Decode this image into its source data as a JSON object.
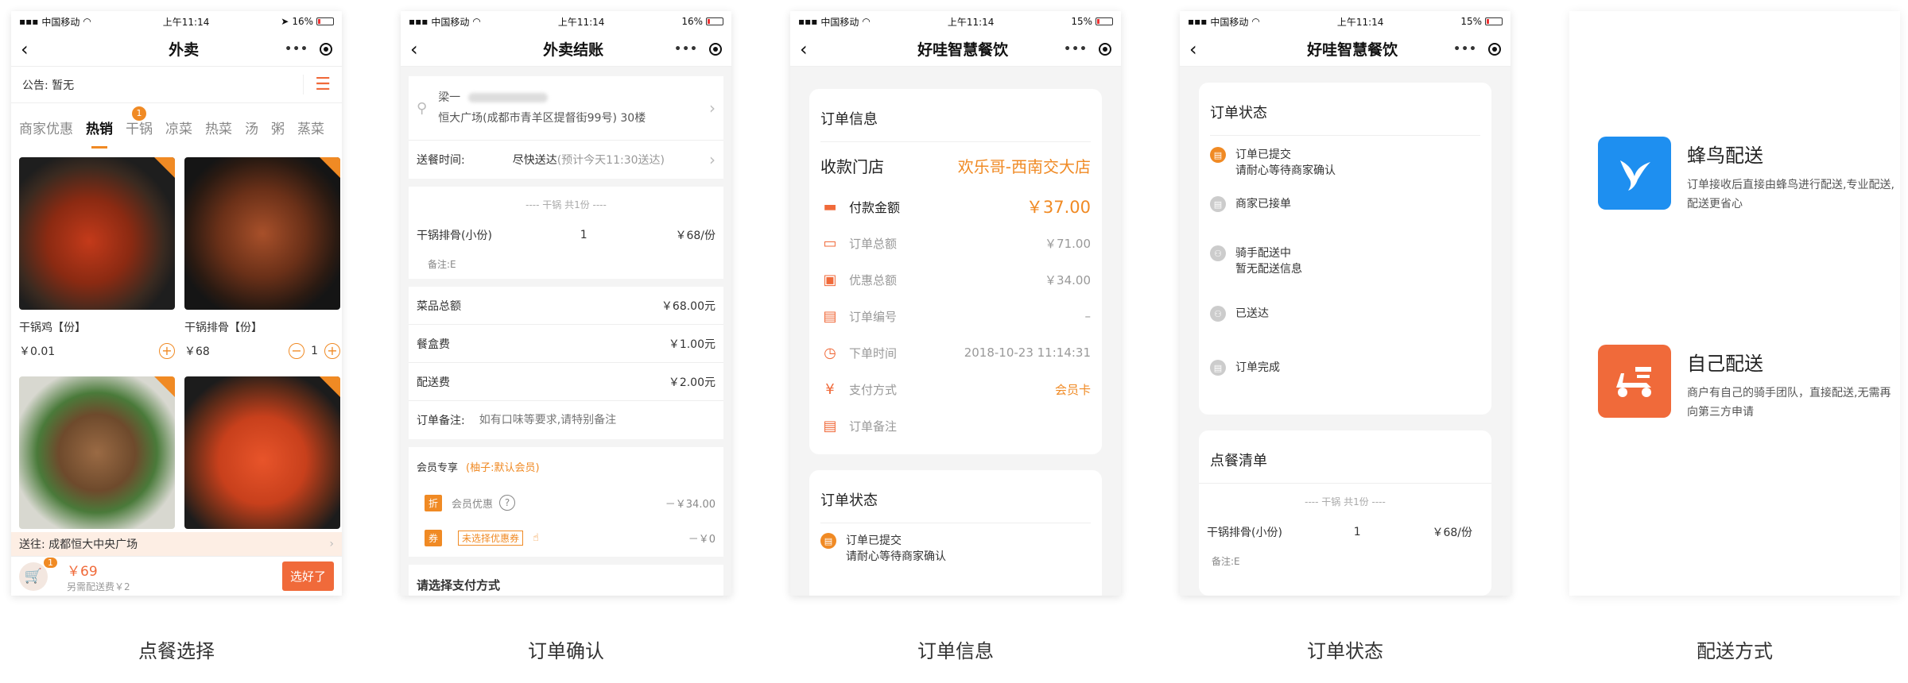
{
  "status": {
    "carrier": "中国移动",
    "time": "上午11:14",
    "s1_batt": "16%",
    "s2_batt": "16%",
    "s3_batt": "15%",
    "s4_batt": "15%"
  },
  "captions": [
    "点餐选择",
    "订单确认",
    "订单信息",
    "订单状态",
    "配送方式"
  ],
  "s1": {
    "title": "外卖",
    "notice": "公告:  暂无",
    "tabs": [
      "商家优惠",
      "热销",
      "干锅",
      "凉菜",
      "热菜",
      "汤",
      "粥",
      "蒸菜"
    ],
    "tab_badge": "1",
    "foods": [
      {
        "name": "干锅鸡【份】",
        "price": "￥0.01"
      },
      {
        "name": "干锅排骨【份】",
        "price": "￥68",
        "qty": "1"
      }
    ],
    "deliver_to": "送往: 成都恒大中央广场",
    "cart_badge": "1",
    "cart_total": "￥69",
    "cart_fee": "另需配送费￥2",
    "choose_btn": "选好了",
    "icons": {
      "plus": "+",
      "minus": "−",
      "chev": "›"
    }
  },
  "s2": {
    "title": "外卖结账",
    "name": "梁一",
    "address": "恒大广场(成都市青羊区提督街99号) 30楼",
    "time_label": "送餐时间:",
    "time_value": "尽快送达",
    "time_hint": "(预计今天11:30送达)",
    "group_label": "---- 干锅 共1份 ----",
    "item_name": "干锅排骨(小份)",
    "item_qty": "1",
    "item_price": "￥68/份",
    "item_note": "备注:E",
    "sum_rows": [
      {
        "label": "菜品总额",
        "value": "￥68.00元"
      },
      {
        "label": "餐盒费",
        "value": "￥1.00元"
      },
      {
        "label": "配送费",
        "value": "￥2.00元"
      }
    ],
    "remark_label": "订单备注:",
    "remark_placeholder": "如有口味等要求,请特别备注",
    "member_label": "会员专享",
    "member_name": "(柚子:默认会员)",
    "discount_tag": "折",
    "discount_label": "会员优惠",
    "discount_value": "－￥34.00",
    "coupon_tag": "券",
    "coupon_label": "未选择优惠券",
    "coupon_value": "－￥0",
    "pay_label": "请选择支付方式"
  },
  "s3": {
    "title": "好哇智慧餐饮",
    "card_title": "订单信息",
    "store_label": "收款门店",
    "store_name": "欢乐哥-西南交大店",
    "pay_label": "付款金额",
    "pay_value": "￥37.00",
    "rows": [
      {
        "label": "订单总额",
        "value": "￥71.00"
      },
      {
        "label": "优惠总额",
        "value": "￥34.00"
      },
      {
        "label": "订单编号",
        "value": "–"
      },
      {
        "label": "下单时间",
        "value": "2018-10-23 11:14:31"
      },
      {
        "label": "支付方式",
        "value": "会员卡"
      },
      {
        "label": "订单备注",
        "value": ""
      }
    ],
    "status_title": "订单状态",
    "status_step": "订单已提交",
    "status_sub": "请耐心等待商家确认"
  },
  "s4": {
    "title": "好哇智慧餐饮",
    "card_title": "订单状态",
    "steps": [
      {
        "title": "订单已提交",
        "sub": "请耐心等待商家确认"
      },
      {
        "title": "商家已接单",
        "sub": ""
      },
      {
        "title": "骑手配送中",
        "sub": "暂无配送信息"
      },
      {
        "title": "已送达",
        "sub": ""
      },
      {
        "title": "订单完成",
        "sub": ""
      }
    ],
    "list_title": "点餐清单",
    "group_label": "---- 干锅 共1份 ----",
    "item_name": "干锅排骨(小份)",
    "item_qty": "1",
    "item_price": "￥68/份",
    "item_note": "备注:E"
  },
  "s5": {
    "m1_title": "蜂鸟配送",
    "m1_desc": "订单接收后直接由蜂鸟进行配送,专业配送,配送更省心",
    "m2_title": "自己配送",
    "m2_desc": "商户有自己的骑手团队，直接配送,无需再向第三方申请"
  },
  "colors": {
    "accent": "#f08a24",
    "red": "#f06a3a",
    "blue": "#1e8ff0"
  }
}
